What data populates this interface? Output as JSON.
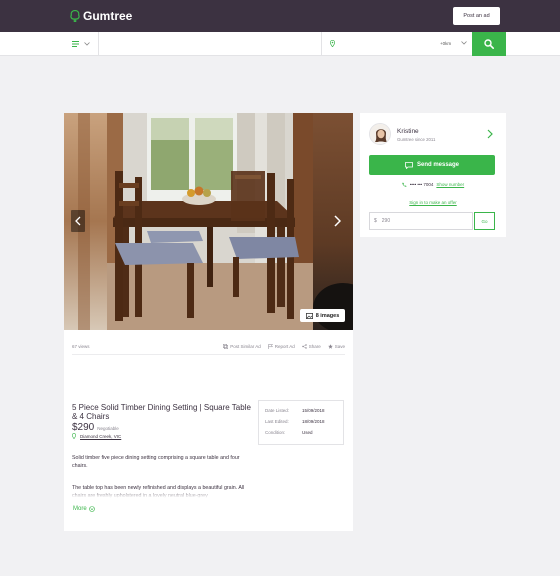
{
  "header": {
    "brand": "Gumtree",
    "post_ad_label": "Post an ad"
  },
  "search": {
    "radius": "+0km",
    "category_icon": "list-icon",
    "location_icon": "pin-icon",
    "search_icon": "magnifier-icon"
  },
  "gallery": {
    "image_count": "8 images"
  },
  "listing": {
    "views": "67 views",
    "actions": {
      "similar": "Post Similar Ad",
      "report": "Report Ad",
      "share": "Share",
      "save": "Save"
    },
    "title": "5 Piece Solid Timber Dining Setting | Square Table & 4 Chairs",
    "price": "$290",
    "negotiable": "Negotiable",
    "location": "Diamond Creek, VIC",
    "details": [
      {
        "label": "Date Listed:",
        "value": "15/09/2018"
      },
      {
        "label": "Last Edited:",
        "value": "18/09/2018"
      },
      {
        "label": "Condition:",
        "value": "Used"
      }
    ],
    "description_1": "Solid timber five piece dining setting comprising a square table and four chairs.",
    "description_2": "The table top has been newly refinished and displays a beautiful grain. All chairs are freshly upholstered in a lovely neutral blue-grey",
    "more_label": "More"
  },
  "seller": {
    "name": "Kristine",
    "member_since": "Gumtree since 2011",
    "send_message": "Send message",
    "phone_masked": "•••• ••• 7004",
    "show_number": "Show number",
    "offer_link": "Sign in to make an offer",
    "offer_placeholder": "290",
    "currency": "$",
    "go_label": "Go"
  },
  "colors": {
    "brand_dark": "#3c3241",
    "accent_green": "#3ab54a",
    "background": "#f1f1f3"
  }
}
